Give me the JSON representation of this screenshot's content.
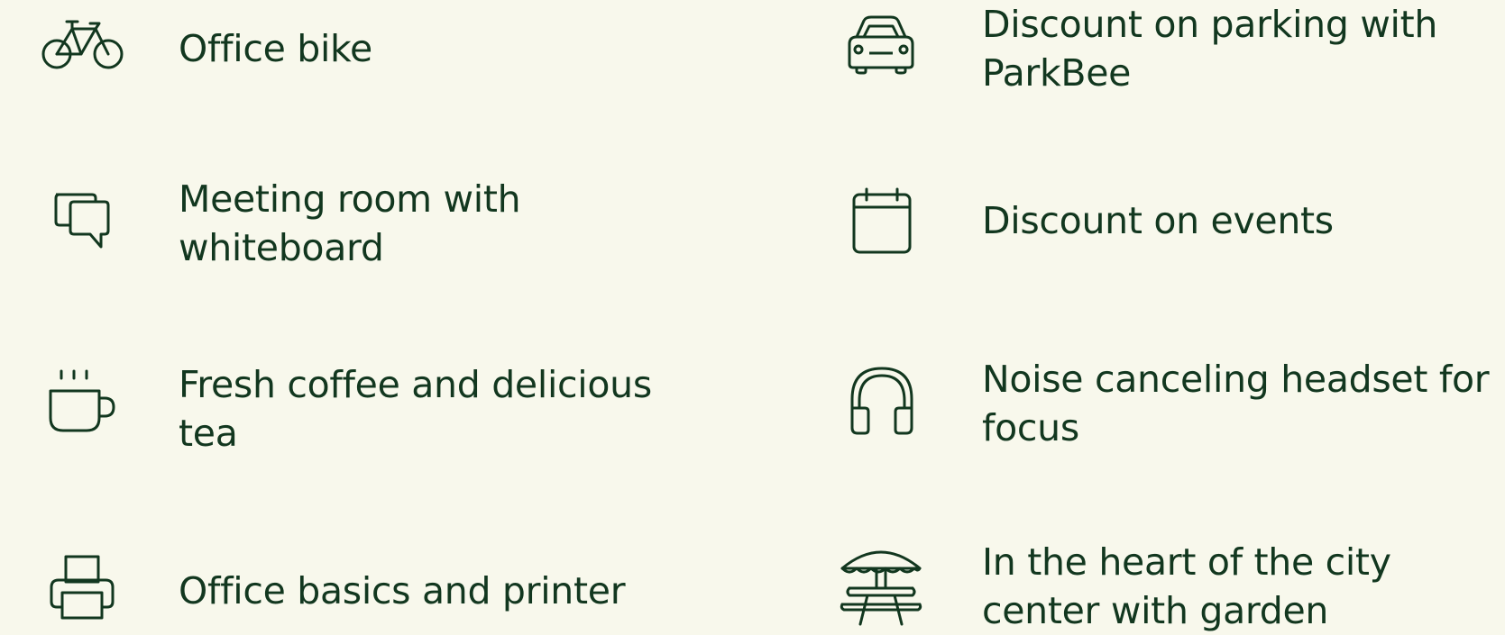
{
  "colors": {
    "background": "#f8f8ec",
    "text": "#12371f",
    "icon_stroke": "#12371f"
  },
  "amenities": {
    "left": [
      {
        "icon": "bicycle-icon",
        "label": "Office bike"
      },
      {
        "icon": "chat-bubbles-icon",
        "label": "Meeting room with whiteboard"
      },
      {
        "icon": "coffee-cup-icon",
        "label": "Fresh coffee and delicious tea"
      },
      {
        "icon": "printer-icon",
        "label": "Office basics and printer"
      }
    ],
    "right": [
      {
        "icon": "car-icon",
        "label": "Discount on parking with ParkBee"
      },
      {
        "icon": "calendar-icon",
        "label": "Discount on events"
      },
      {
        "icon": "headphones-icon",
        "label": "Noise canceling headset for focus"
      },
      {
        "icon": "picnic-table-umbrella-icon",
        "label": "In the heart of the city center with garden"
      }
    ]
  }
}
